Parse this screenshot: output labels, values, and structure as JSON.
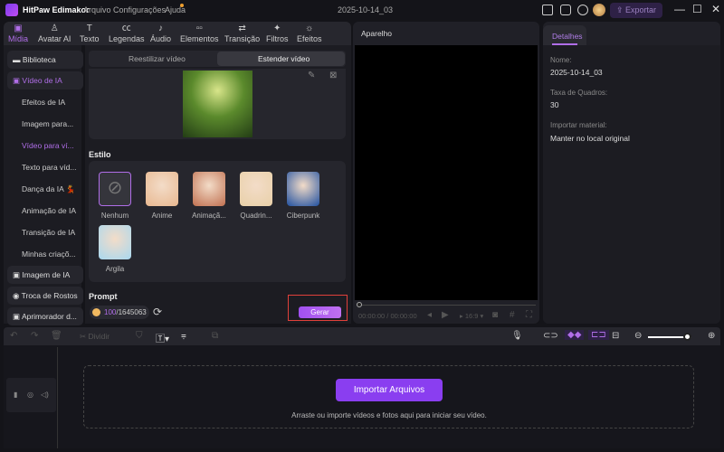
{
  "app": {
    "title": "HitPaw Edimakor",
    "menu": [
      "Arquivo",
      "Configurações",
      "Ajuda"
    ],
    "project_name": "2025-10-14_03",
    "export_label": "Exportar"
  },
  "toolbar": [
    {
      "label": "Mídia",
      "icon": "media-icon"
    },
    {
      "label": "Avatar AI",
      "icon": "avatar-icon"
    },
    {
      "label": "Texto",
      "icon": "text-icon"
    },
    {
      "label": "Legendas",
      "icon": "captions-icon"
    },
    {
      "label": "Áudio",
      "icon": "audio-icon"
    },
    {
      "label": "Elementos",
      "icon": "elements-icon"
    },
    {
      "label": "Transição",
      "icon": "transition-icon"
    },
    {
      "label": "Filtros",
      "icon": "filters-icon"
    },
    {
      "label": "Efeitos",
      "icon": "effects-icon"
    }
  ],
  "sidebar": {
    "main": [
      {
        "label": "Biblioteca"
      },
      {
        "label": "Vídeo de IA"
      },
      {
        "label": "Imagem de IA"
      },
      {
        "label": "Troca de Rostos"
      },
      {
        "label": "Aprimorador d..."
      }
    ],
    "sub": [
      "Efeitos de IA",
      "Imagem para...",
      "Vídeo para ví...",
      "Texto para víd...",
      "Dança da IA 💃",
      "Animação de IA",
      "Transição de IA",
      "Minhas criaçõ..."
    ]
  },
  "segment": {
    "tabs": [
      "Reestilizar vídeo",
      "Estender vídeo"
    ],
    "active": 1
  },
  "style": {
    "heading": "Estilo",
    "options": [
      "Nenhum",
      "Anime",
      "Animaçã...",
      "Quadrin...",
      "Ciberpunk",
      "Argila"
    ],
    "selected": 0,
    "colors": [
      "#333",
      "#e8b890",
      "#c07050",
      "#e8d0a8",
      "#2050a0",
      "#a8d8f0"
    ]
  },
  "prompt": {
    "heading": "Prompt",
    "credits_used": "100",
    "credits_total": "/1645063",
    "generate_label": "Gerar"
  },
  "preview": {
    "title": "Aparelho",
    "time": "00:00:00 / 00:00:00",
    "ratio": "16:9"
  },
  "details": {
    "tab": "Detalhes",
    "fields": [
      {
        "label": "Nome:",
        "value": "2025-10-14_03"
      },
      {
        "label": "Taxa de Quadros:",
        "value": "30"
      },
      {
        "label": "Importar material:",
        "value": "Manter no local original"
      }
    ]
  },
  "timeline": {
    "split_label": "Dividir",
    "import_label": "Importar Arquivos",
    "hint": "Arraste ou importe vídeos e fotos aqui para iniciar seu vídeo.",
    "zoom_level": 0.9
  }
}
